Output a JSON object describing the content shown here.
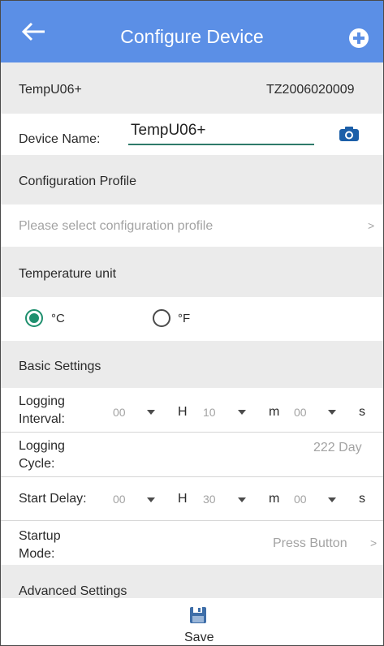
{
  "header": {
    "title": "Configure Device",
    "back_icon": "arrow-left-icon",
    "add_icon": "plus-circle-icon",
    "color": "#5b8fe6"
  },
  "device": {
    "model": "TempU06+",
    "serial": "TZ2006020009",
    "name_label": "Device Name:",
    "name_value": "TempU06+",
    "camera_icon": "camera-icon"
  },
  "profile": {
    "section_label": "Configuration Profile",
    "placeholder": "Please select configuration profile",
    "chevron": ">"
  },
  "temperature": {
    "section_label": "Temperature unit",
    "celsius": "°C",
    "fahrenheit": "°F",
    "selected": "celsius"
  },
  "basic": {
    "section_label": "Basic Settings",
    "logging_interval": {
      "label_line1": "Logging",
      "label_line2": "Interval:",
      "hours": "00",
      "hours_unit": "H",
      "minutes": "10",
      "minutes_unit": "m",
      "seconds": "00",
      "seconds_unit": "s"
    },
    "logging_cycle": {
      "label_line1": "Logging",
      "label_line2": "Cycle:",
      "value": "222 Day"
    },
    "start_delay": {
      "label": "Start Delay:",
      "hours": "00",
      "hours_unit": "H",
      "minutes": "30",
      "minutes_unit": "m",
      "seconds": "00",
      "seconds_unit": "s"
    },
    "startup_mode": {
      "label_line1": "Startup",
      "label_line2": "Mode:",
      "value": "Press Button",
      "chevron": ">"
    }
  },
  "advanced": {
    "section_label": "Advanced Settings"
  },
  "footer": {
    "save_label": "Save",
    "save_icon": "floppy-disk-icon"
  }
}
